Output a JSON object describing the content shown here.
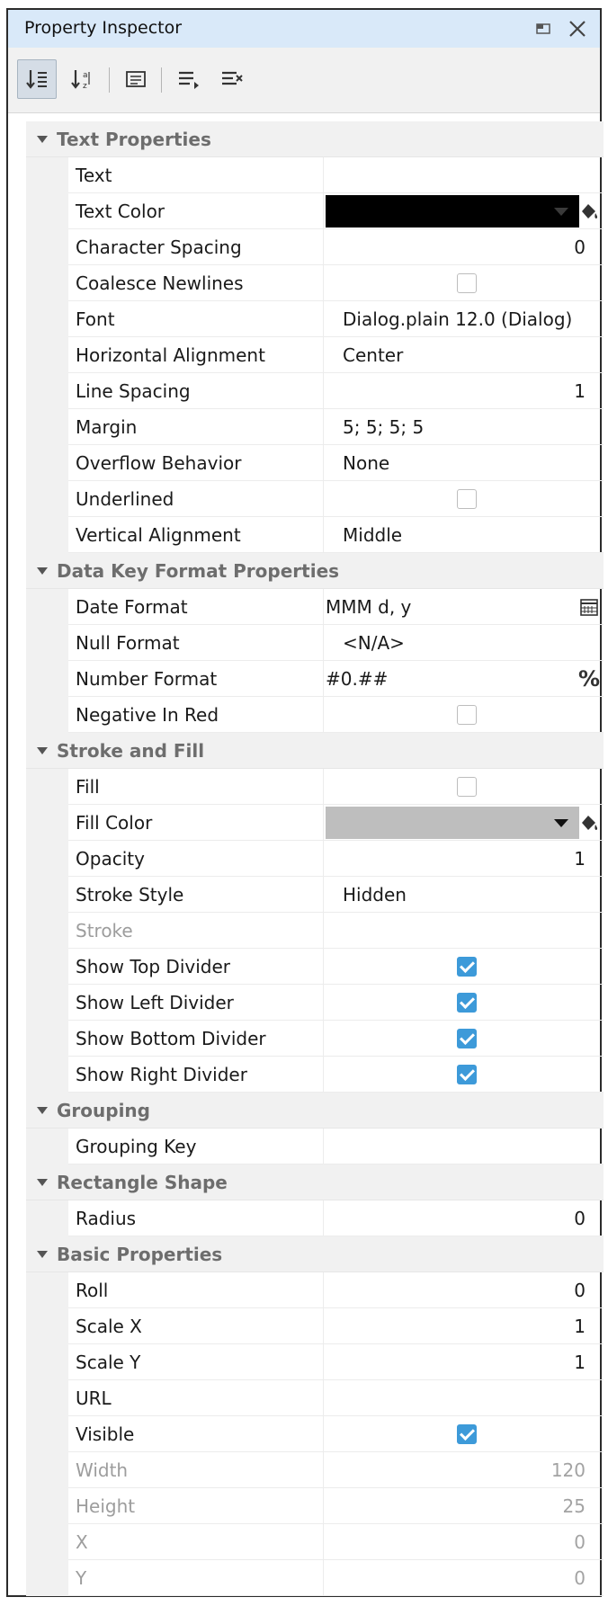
{
  "window": {
    "title": "Property Inspector"
  },
  "toolbar": {
    "buttons": [
      "sort-categorized",
      "sort-alphabetical",
      "show-customizers",
      "expand-all",
      "collapse-all"
    ]
  },
  "colors": {
    "title_bg": "#d9e9f9",
    "text_color": "#000000",
    "fill_color": "#bebebe",
    "checkbox_checked": "#3d9ad9"
  },
  "sections": {
    "text": {
      "title": "Text Properties",
      "rows": [
        {
          "name": "Text",
          "value": ""
        },
        {
          "name": "Text Color",
          "value": ""
        },
        {
          "name": "Character Spacing",
          "value": "0"
        },
        {
          "name": "Coalesce Newlines",
          "checked": false
        },
        {
          "name": "Font",
          "value": "Dialog.plain 12.0 (Dialog)"
        },
        {
          "name": "Horizontal Alignment",
          "value": "Center"
        },
        {
          "name": "Line Spacing",
          "value": "1"
        },
        {
          "name": "Margin",
          "value": "5; 5; 5; 5"
        },
        {
          "name": "Overflow Behavior",
          "value": "None"
        },
        {
          "name": "Underlined",
          "checked": false
        },
        {
          "name": "Vertical Alignment",
          "value": "Middle"
        }
      ]
    },
    "datakey": {
      "title": "Data Key Format Properties",
      "rows": [
        {
          "name": "Date Format",
          "value": "MMM d, y"
        },
        {
          "name": "Null Format",
          "value": "<N/A>"
        },
        {
          "name": "Number Format",
          "value": "#0.##",
          "icon": "%"
        },
        {
          "name": "Negative In Red",
          "checked": false
        }
      ]
    },
    "stroke": {
      "title": "Stroke and Fill",
      "rows": [
        {
          "name": "Fill",
          "checked": false
        },
        {
          "name": "Fill Color",
          "value": ""
        },
        {
          "name": "Opacity",
          "value": "1"
        },
        {
          "name": "Stroke Style",
          "value": "Hidden"
        },
        {
          "name": "Stroke",
          "value": ""
        },
        {
          "name": "Show Top Divider",
          "checked": true
        },
        {
          "name": "Show Left Divider",
          "checked": true
        },
        {
          "name": "Show Bottom Divider",
          "checked": true
        },
        {
          "name": "Show Right Divider",
          "checked": true
        }
      ]
    },
    "grouping": {
      "title": "Grouping",
      "rows": [
        {
          "name": "Grouping Key",
          "value": ""
        }
      ]
    },
    "rect": {
      "title": "Rectangle Shape",
      "rows": [
        {
          "name": "Radius",
          "value": "0"
        }
      ]
    },
    "basic": {
      "title": "Basic Properties",
      "rows": [
        {
          "name": "Roll",
          "value": "0"
        },
        {
          "name": "Scale X",
          "value": "1"
        },
        {
          "name": "Scale Y",
          "value": "1"
        },
        {
          "name": "URL",
          "value": ""
        },
        {
          "name": "Visible",
          "checked": true
        },
        {
          "name": "Width",
          "value": "120"
        },
        {
          "name": "Height",
          "value": "25"
        },
        {
          "name": "X",
          "value": "0"
        },
        {
          "name": "Y",
          "value": "0"
        }
      ]
    }
  }
}
